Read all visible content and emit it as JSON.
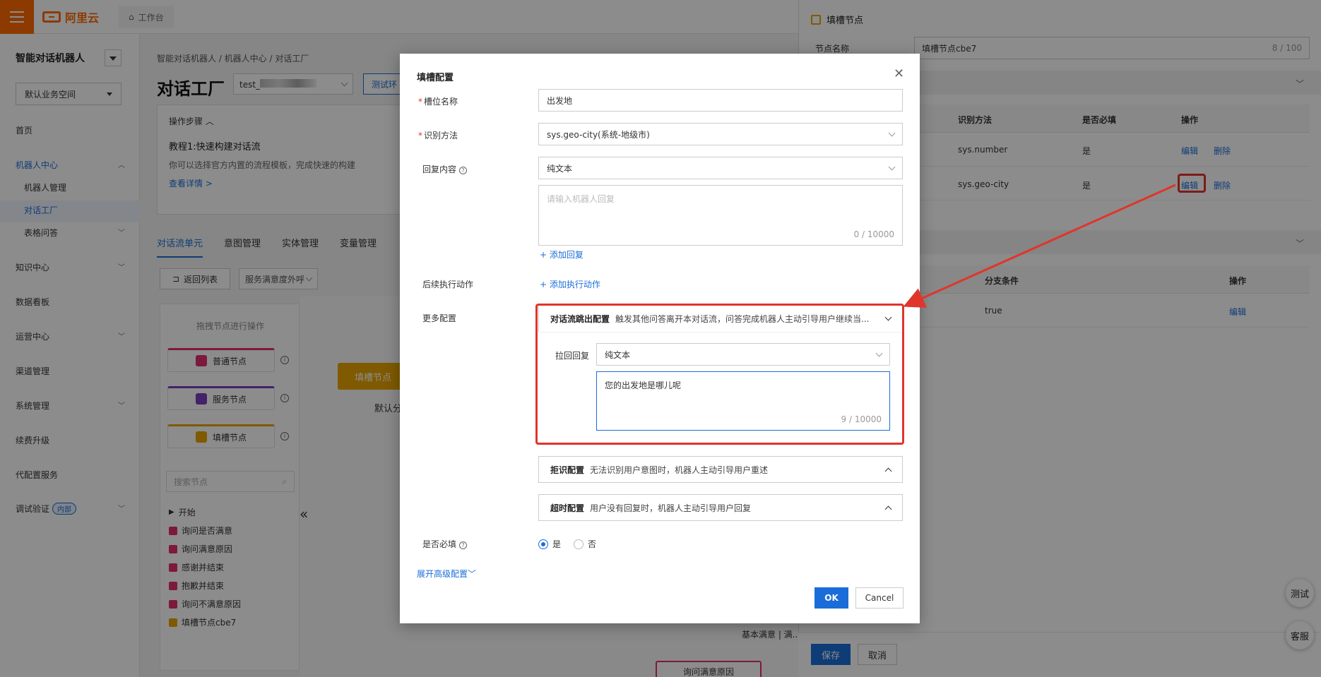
{
  "topbar": {
    "logo_text": "阿里云",
    "workspace_tab": "工作台"
  },
  "sidebar": {
    "title": "智能对话机器人",
    "space_select": "默认业务空间",
    "items": [
      {
        "label": "首页"
      },
      {
        "label": "机器人中心",
        "expanded": true
      },
      {
        "label": "机器人管理"
      },
      {
        "label": "对话工厂",
        "active": true
      },
      {
        "label": "表格问答"
      },
      {
        "label": "知识中心"
      },
      {
        "label": "数据看板"
      },
      {
        "label": "运营中心"
      },
      {
        "label": "渠道管理"
      },
      {
        "label": "系统管理"
      },
      {
        "label": "续费升级"
      },
      {
        "label": "代配置服务"
      },
      {
        "label": "调试验证",
        "badge": "内部"
      }
    ]
  },
  "main": {
    "breadcrumb": "智能对话机器人  /  机器人中心  /  对话工厂",
    "page_title": "对话工厂",
    "env_select": "test_",
    "test_button": "测试环",
    "steps": {
      "header": "操作步骤",
      "tutorial": "教程1:快速构建对话流",
      "desc": "你可以选择官方内置的流程模板，完成快速的构建",
      "more_link": "查看详情 >"
    },
    "tabs": [
      "对话流单元",
      "意图管理",
      "实体管理",
      "变量管理"
    ],
    "back_button": "返回列表",
    "flow_select": "服务满意度外呼",
    "palette": {
      "hint": "拖拽节点进行操作",
      "nodes": [
        {
          "label": "普通节点",
          "color": "#e52e71"
        },
        {
          "label": "服务节点",
          "color": "#7b3fbf"
        },
        {
          "label": "填槽节点",
          "color": "#e8a400"
        }
      ],
      "search_placeholder": "搜索节点",
      "tree": [
        {
          "label": "开始",
          "kind": "start"
        },
        {
          "label": "询问是否满意",
          "color": "#e52e71"
        },
        {
          "label": "询问满意原因",
          "color": "#e52e71"
        },
        {
          "label": "感谢并结束",
          "color": "#e52e71"
        },
        {
          "label": "抱歉并结束",
          "color": "#e52e71"
        },
        {
          "label": "询问不满意原因",
          "color": "#e52e71"
        },
        {
          "label": "填槽节点cbe7",
          "color": "#e8a400"
        }
      ]
    },
    "canvas": {
      "node1": "填槽节点",
      "node1_branch": "默认分",
      "node2_branch": "基本满意 | 满...",
      "node2": "询问满意原因"
    }
  },
  "drawer": {
    "title": "填槽节点",
    "name_label": "节点名称",
    "name_value": "填槽节点cbe7",
    "name_count": "8 / 100",
    "slot_table": {
      "headers": [
        "识别方法",
        "是否必填",
        "操作"
      ],
      "rows": [
        {
          "method": "sys.number",
          "required": "是",
          "edit": "编辑",
          "delete": "删除"
        },
        {
          "method": "sys.geo-city",
          "required": "是",
          "edit": "编辑",
          "delete": "删除"
        }
      ]
    },
    "branch_table": {
      "headers": [
        "分支条件",
        "操作"
      ],
      "rows": [
        {
          "condition": "true",
          "edit": "编辑"
        }
      ]
    },
    "save_button": "保存",
    "cancel_button": "取消"
  },
  "fabs": {
    "test": "测试",
    "service": "客服"
  },
  "modal": {
    "title": "填槽配置",
    "slot_name_label": "槽位名称",
    "slot_name_value": "出发地",
    "method_label": "识别方法",
    "method_value": "sys.geo-city(系统-地级市)",
    "reply_label": "回复内容",
    "reply_type": "纯文本",
    "reply_placeholder": "请输入机器人回复",
    "reply_count": "0 / 10000",
    "add_reply": "+ 添加回复",
    "followup_label": "后续执行动作",
    "add_action": "+ 添加执行动作",
    "more_label": "更多配置",
    "jump_config": {
      "title": "对话流跳出配置",
      "desc": "触发其他问答离开本对话流，问答完成机器人主动引导用户继续当...",
      "pullback_label": "拉回回复",
      "pullback_type": "纯文本",
      "pullback_text": "您的出发地是哪儿呢",
      "pullback_count": "9 / 10000"
    },
    "reject_config": {
      "title": "拒识配置",
      "desc": "无法识别用户意图时，机器人主动引导用户重述"
    },
    "timeout_config": {
      "title": "超时配置",
      "desc": "用户没有回复时，机器人主动引导用户回复"
    },
    "required_label": "是否必填",
    "required_yes": "是",
    "required_no": "否",
    "advanced_link": "展开高级配置",
    "ok_button": "OK",
    "cancel_button": "Cancel"
  },
  "colors": {
    "accent": "#1a6dd8",
    "brand": "#ff6a00",
    "annotation": "#e0352b"
  }
}
